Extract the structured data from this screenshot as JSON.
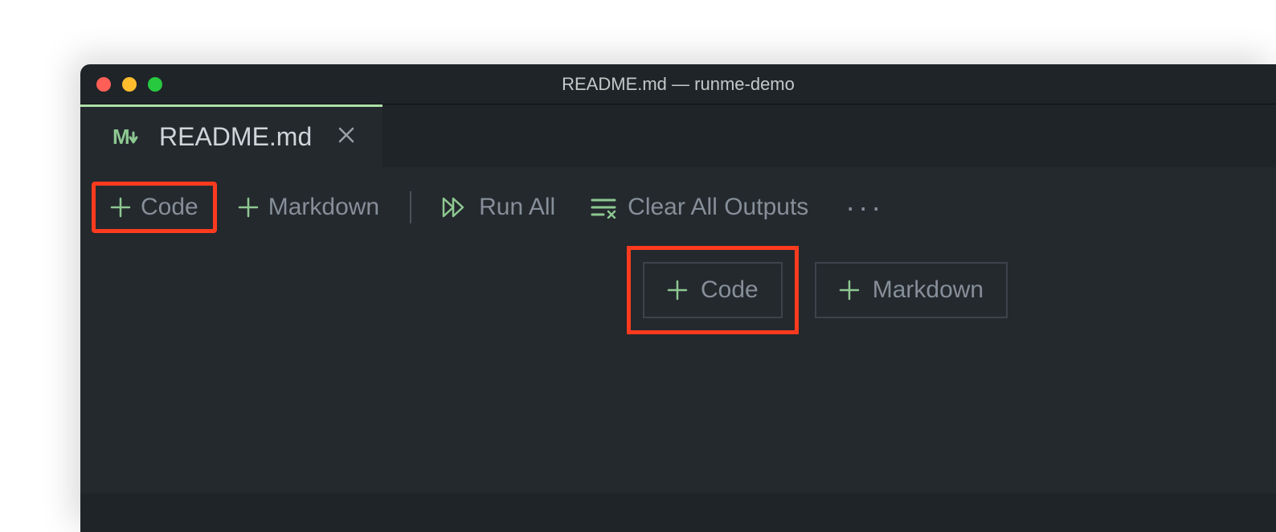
{
  "window": {
    "title": "README.md — runme-demo"
  },
  "tab": {
    "label": "README.md"
  },
  "toolbar": {
    "code_label": "Code",
    "markdown_label": "Markdown",
    "run_all_label": "Run All",
    "clear_outputs_label": "Clear All Outputs"
  },
  "inserter": {
    "code_label": "Code",
    "markdown_label": "Markdown"
  }
}
